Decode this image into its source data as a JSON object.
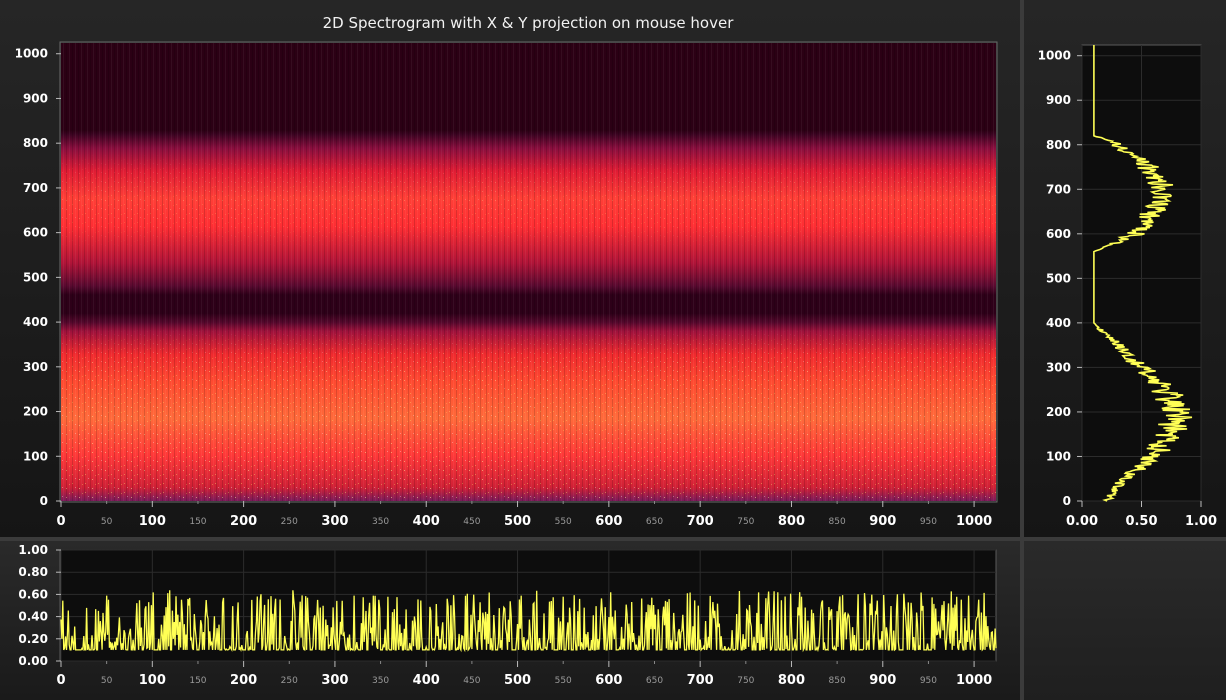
{
  "chart_data": [
    {
      "type": "heatmap",
      "title": "2D Spectrogram with X & Y projection on mouse hover",
      "xlabel": "",
      "ylabel": "",
      "xlim": [
        0,
        1024
      ],
      "ylim": [
        0,
        1024
      ],
      "x_major_ticks": [
        "0",
        "100",
        "200",
        "300",
        "400",
        "500",
        "600",
        "700",
        "800",
        "900",
        "1000"
      ],
      "x_minor_ticks": [
        "50",
        "150",
        "250",
        "350",
        "450",
        "550",
        "650",
        "750",
        "850",
        "950"
      ],
      "y_ticks": [
        "0",
        "100",
        "200",
        "300",
        "400",
        "500",
        "600",
        "700",
        "800",
        "900",
        "1000"
      ],
      "bands": [
        {
          "from": 0,
          "to": 400,
          "peak": 180
        },
        {
          "from": 460,
          "to": 820,
          "peak": 650
        }
      ],
      "colormap": [
        "#2b0015",
        "#6a0a3a",
        "#c01535",
        "#ff2a2a",
        "#ffd24a"
      ]
    },
    {
      "type": "line",
      "xlim": [
        0,
        1024
      ],
      "ylim": [
        0,
        1
      ],
      "x_major_ticks": [
        "0",
        "100",
        "200",
        "300",
        "400",
        "500",
        "600",
        "700",
        "800",
        "900",
        "1000"
      ],
      "x_minor_ticks": [
        "50",
        "150",
        "250",
        "350",
        "450",
        "550",
        "650",
        "750",
        "850",
        "950"
      ],
      "y_ticks": [
        "0.00",
        "0.20",
        "0.40",
        "0.60",
        "0.80",
        "1.00"
      ],
      "baseline": 0.1,
      "typical_range": [
        0.1,
        0.62
      ],
      "color": "#ffff55"
    },
    {
      "type": "line",
      "xlim": [
        0,
        1
      ],
      "ylim": [
        0,
        1024
      ],
      "x_ticks": [
        "0.00",
        "0.50",
        "1.00"
      ],
      "y_ticks": [
        "0",
        "100",
        "200",
        "300",
        "400",
        "500",
        "600",
        "700",
        "800",
        "900",
        "1000"
      ],
      "profile": [
        {
          "y": 0,
          "x": 0.2
        },
        {
          "y": 50,
          "x": 0.35
        },
        {
          "y": 100,
          "x": 0.6
        },
        {
          "y": 150,
          "x": 0.75
        },
        {
          "y": 200,
          "x": 0.8
        },
        {
          "y": 250,
          "x": 0.7
        },
        {
          "y": 300,
          "x": 0.5
        },
        {
          "y": 350,
          "x": 0.3
        },
        {
          "y": 400,
          "x": 0.1
        },
        {
          "y": 560,
          "x": 0.1
        },
        {
          "y": 600,
          "x": 0.45
        },
        {
          "y": 650,
          "x": 0.6
        },
        {
          "y": 700,
          "x": 0.7
        },
        {
          "y": 750,
          "x": 0.55
        },
        {
          "y": 800,
          "x": 0.3
        },
        {
          "y": 820,
          "x": 0.1
        },
        {
          "y": 1024,
          "x": 0.1
        }
      ],
      "color": "#ffff55"
    }
  ]
}
